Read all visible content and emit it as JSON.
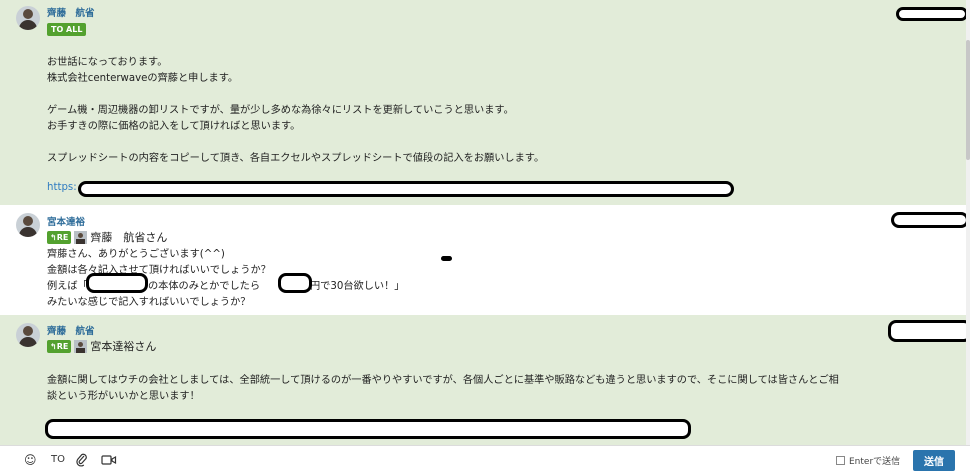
{
  "messages": [
    {
      "sender": "齊藤　航省",
      "badge": "TO ALL",
      "lines": [
        "お世話になっております。",
        "株式会社centerwaveの齊藤と申します。",
        "ゲーム機・周辺機器の卸リストですが、量が少し多めな為徐々にリストを更新していこうと思います。",
        "お手すきの際に価格の記入をして頂ければと思います。",
        "スプレッドシートの内容をコピーして頂き、各自エクセルやスプレッドシートで値段の記入をお願いします。",
        "https:"
      ]
    },
    {
      "sender": "宮本達裕",
      "re_label": "RE",
      "re_name": "齊藤　航省さん",
      "lines": [
        "齊藤さん、ありがとうございます(^^)",
        "金額は各々記入させて頂ければいいでしょうか？",
        "例えば「",
        "の本体のみとかでしたら",
        "円で30台欲しい！」",
        "みたいな感じで記入すればいいでしょうか？"
      ]
    },
    {
      "sender": "齊藤　航省",
      "re_label": "RE",
      "re_name": "宮本達裕さん",
      "lines": [
        "金額に関してはウチの会社としましては、全部統一して頂けるのが一番やりやすいですが、各個人ごとに基準や販路なども違うと思いますので、そこに関しては皆さんとご相",
        "談という形がいいかと思います！"
      ]
    }
  ],
  "toolbar": {
    "emoji_icon": "smile-icon",
    "to_label": "TO",
    "attach_icon": "paperclip-icon",
    "video_icon": "video-icon",
    "enter_label": "Enterで送信",
    "send_label": "送信"
  },
  "colors": {
    "own_message_bg": "#e2ecd9",
    "badge_green": "#53a12f",
    "sender_blue": "#2f6d9a",
    "send_button": "#2a74ad"
  }
}
